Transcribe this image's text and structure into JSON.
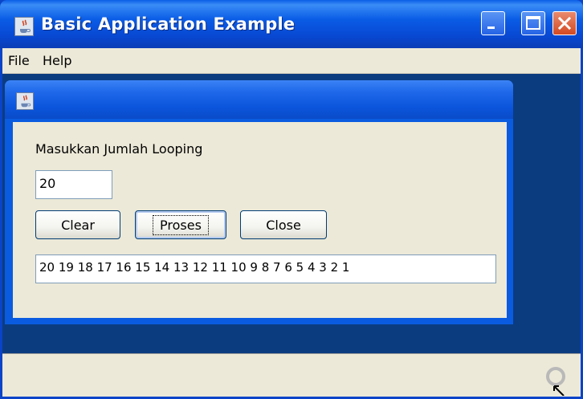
{
  "window": {
    "title": "Basic Application Example"
  },
  "menubar": {
    "items": [
      {
        "label": "File"
      },
      {
        "label": "Help"
      }
    ]
  },
  "internal_frame": {
    "prompt_label": "Masukkan Jumlah Looping",
    "count_input_value": "20",
    "buttons": {
      "clear": "Clear",
      "proses": "Proses",
      "close": "Close"
    },
    "output_value": "20 19 18 17 16 15 14 13 12 11 10 9 8 7 6 5 4 3 2 1"
  },
  "icons": {
    "app": "java-cup-icon",
    "minimize": "minimize-icon",
    "maximize": "maximize-icon",
    "close": "close-icon",
    "resize": "resize-grip-icon"
  },
  "colors": {
    "titlebar": "#0a5de6",
    "desktop": "#0b3c80",
    "panel": "#ece9d8",
    "close_button": "#d44a22"
  }
}
